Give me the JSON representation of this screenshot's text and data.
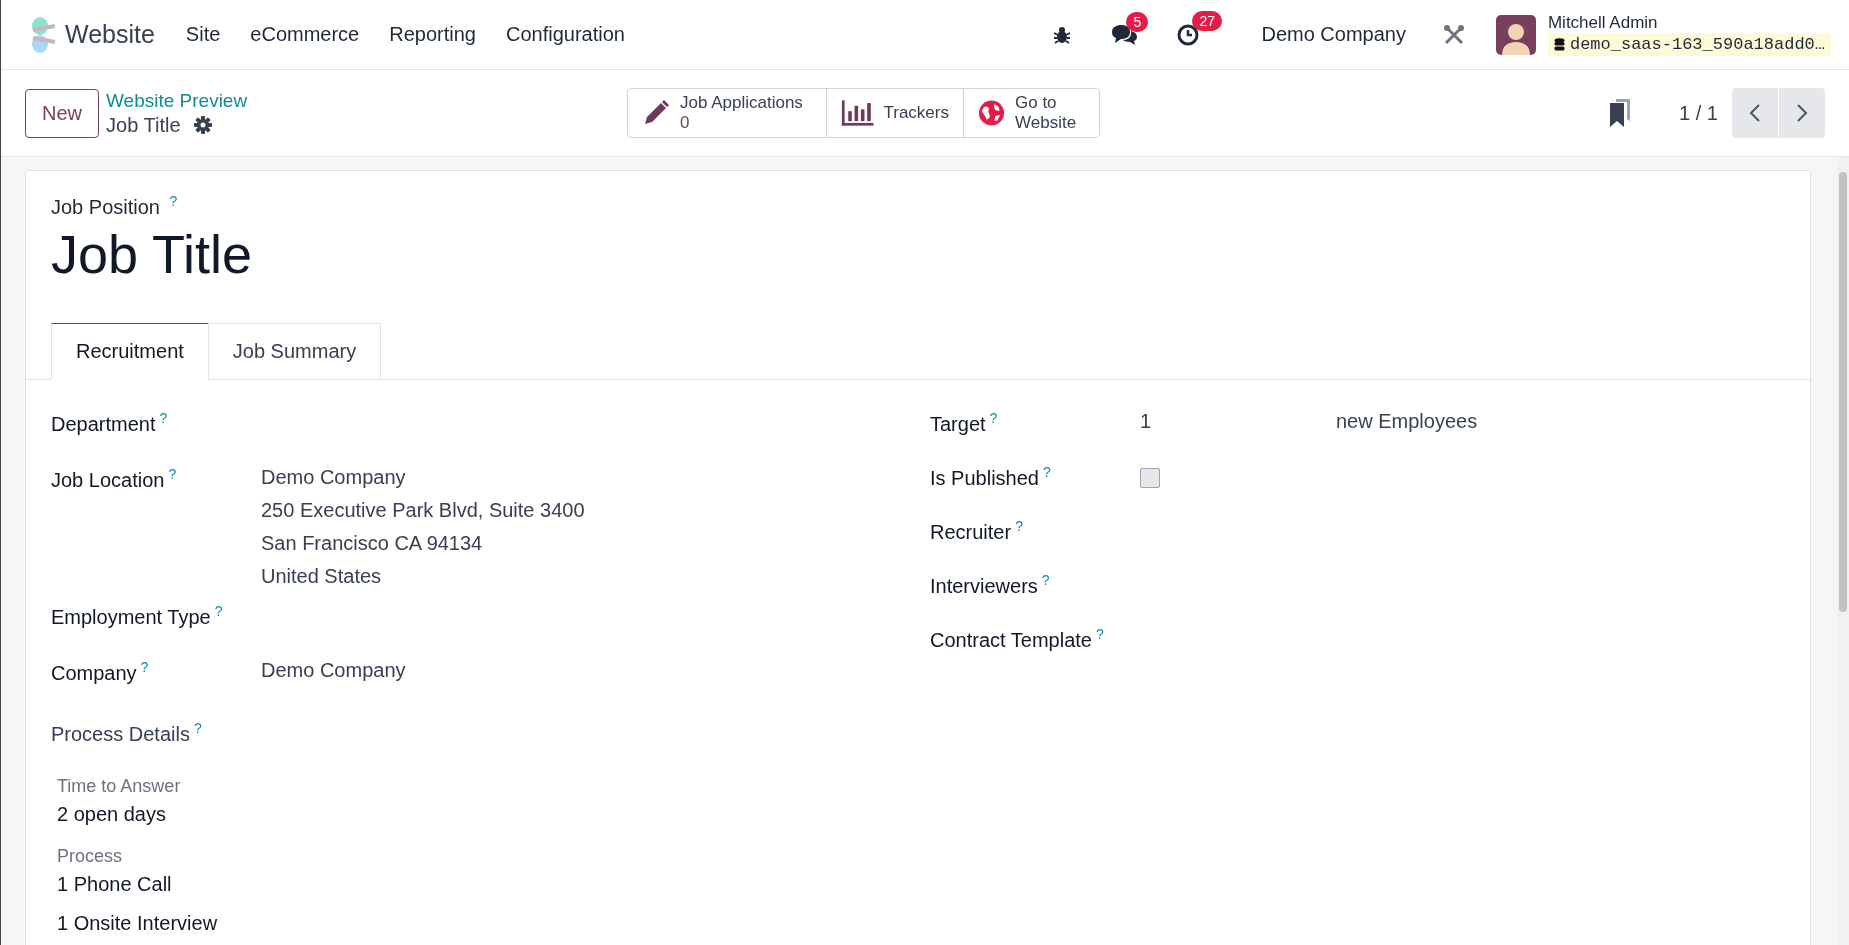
{
  "navbar": {
    "app_name": "Website",
    "menu": [
      "Site",
      "eCommerce",
      "Reporting",
      "Configuration"
    ],
    "messages_count": "5",
    "activities_count": "27",
    "company": "Demo Company",
    "user_name": "Mitchell Admin",
    "database": "demo_saas-163_590a18add0…"
  },
  "control_panel": {
    "new_button": "New",
    "breadcrumb": "Website Preview",
    "current": "Job Title",
    "smart_buttons": [
      {
        "kind": "stat",
        "label": "Job Applications",
        "value": "0"
      },
      {
        "kind": "chart",
        "label": "Trackers"
      },
      {
        "kind": "globe",
        "label": "Go to Website"
      }
    ],
    "pager": "1 / 1"
  },
  "form": {
    "name_label": "Job Position",
    "name_help": "?",
    "title": "Job Title",
    "tabs": [
      {
        "label": "Recruitment",
        "selected": true
      },
      {
        "label": "Job Summary",
        "selected": false
      }
    ],
    "left_fields": [
      {
        "label": "Department",
        "help": "?"
      },
      {
        "label": "Job Location",
        "help": "?",
        "lines": [
          "Demo Company",
          "250 Executive Park Blvd, Suite 3400",
          "San Francisco CA 94134",
          "United States"
        ]
      },
      {
        "label": "Employment Type",
        "help": "?"
      },
      {
        "label": "Company",
        "help": "?",
        "lines": [
          "Demo Company"
        ]
      }
    ],
    "process_details": {
      "label": "Process Details",
      "help": "?",
      "groups": [
        {
          "label": "Time to Answer",
          "items": [
            "2 open days"
          ]
        },
        {
          "label": "Process",
          "items": [
            "1 Phone Call",
            "1 Onsite Interview"
          ]
        }
      ]
    },
    "right_fields": [
      {
        "kind": "number",
        "label": "Target",
        "help": "?",
        "value": "1",
        "unit": "new Employees"
      },
      {
        "kind": "checkbox",
        "label": "Is Published",
        "help": "?",
        "checked": false
      },
      {
        "kind": "empty",
        "label": "Recruiter",
        "help": "?"
      },
      {
        "kind": "empty",
        "label": "Interviewers",
        "help": "?"
      },
      {
        "kind": "empty",
        "label": "Contract Template",
        "help": "?"
      }
    ]
  }
}
